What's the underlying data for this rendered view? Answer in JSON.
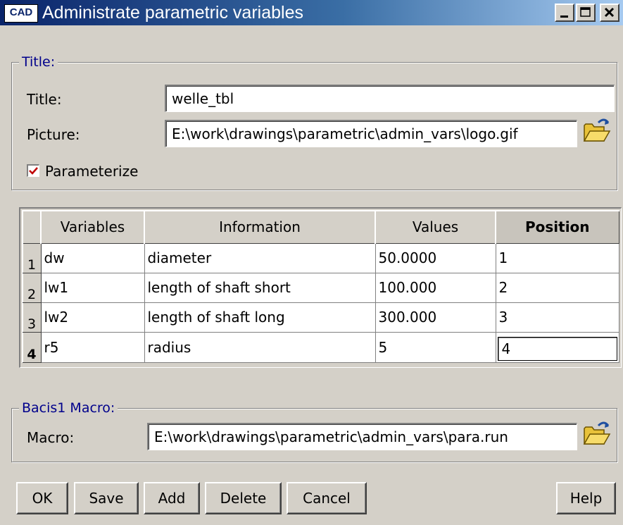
{
  "window": {
    "title": "Administrate parametric variables",
    "app_icon_text": "CAD",
    "controls": [
      "minimize",
      "maximize",
      "close"
    ]
  },
  "title_group": {
    "legend": "Title:",
    "title_label": "Title:",
    "title_value": "welle_tbl",
    "picture_label": "Picture:",
    "picture_value": "E:\\work\\drawings\\parametric\\admin_vars\\logo.gif",
    "parameterize_label": "Parameterize",
    "parameterize_checked": true
  },
  "table": {
    "columns": [
      "Variables",
      "Information",
      "Values",
      "Position"
    ],
    "sorted_column": "Position",
    "rows": [
      {
        "num": "1",
        "variable": "dw",
        "information": "diameter",
        "value": "50.0000",
        "position": "1"
      },
      {
        "num": "2",
        "variable": "lw1",
        "information": "length of shaft short",
        "value": "100.000",
        "position": "2"
      },
      {
        "num": "3",
        "variable": "lw2",
        "information": "length of shaft long",
        "value": "300.000",
        "position": "3"
      },
      {
        "num": "4",
        "variable": "r5",
        "information": "radius",
        "value": "5",
        "position": "4"
      }
    ],
    "active_row": "4"
  },
  "macro_group": {
    "legend": "Bacis1 Macro:",
    "macro_label": "Macro:",
    "macro_value": "E:\\work\\drawings\\parametric\\admin_vars\\para.run"
  },
  "buttons": {
    "ok": "OK",
    "save": "Save",
    "add": "Add",
    "delete": "Delete",
    "cancel": "Cancel",
    "help": "Help"
  },
  "icons": {
    "browse": "open-folder-icon",
    "check": "checkmark-icon"
  },
  "colors": {
    "titlebar_start": "#0a246a",
    "titlebar_end": "#a6caf0",
    "face": "#d4d0c8",
    "legend_text": "#00008b",
    "checkmark": "#c00000"
  }
}
